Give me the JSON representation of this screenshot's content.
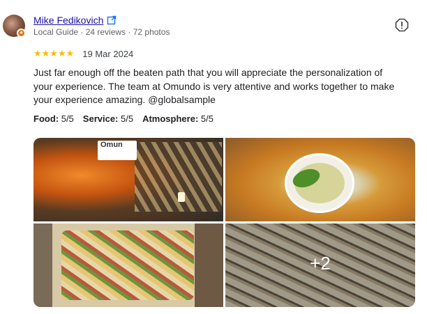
{
  "author": {
    "name": "Mike Fedikovich",
    "meta": "Local Guide · 24 reviews · 72 photos"
  },
  "review": {
    "stars": "★★★★★",
    "rating": 5,
    "date": "19 Mar 2024",
    "text": "Just far enough off the beaten path that you will appreciate the personalization of your experience. The team at Omundo is very attentive and works together to make your experience amazing. @globalsample"
  },
  "attributes": [
    {
      "label": "Food:",
      "value": "5/5"
    },
    {
      "label": "Service:",
      "value": "5/5"
    },
    {
      "label": "Atmosphere:",
      "value": "5/5"
    }
  ],
  "photos": {
    "sign_text": "Omun",
    "more_label": "+2"
  },
  "colors": {
    "link": "#1a0dab",
    "star": "#fbbc04",
    "muted": "#5f6368",
    "guide_badge": "#e8710a"
  },
  "icons": [
    "external-link-icon",
    "report-icon",
    "local-guide-badge-icon"
  ]
}
